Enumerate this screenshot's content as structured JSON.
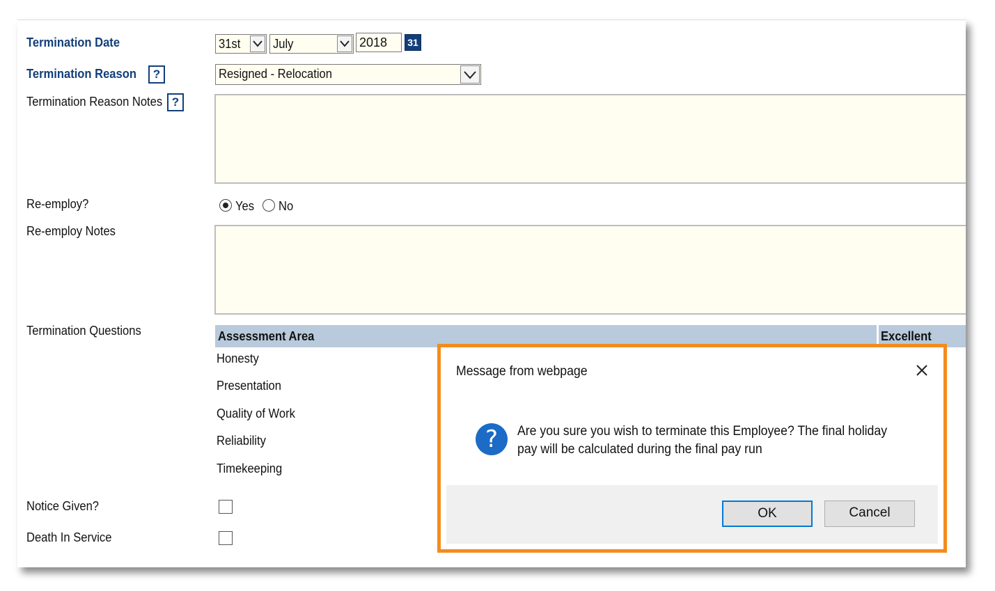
{
  "form": {
    "termination_date_label": "Termination Date",
    "date_day": "31st",
    "date_month": "July",
    "date_year": "2018",
    "calendar_label": "31",
    "termination_reason_label": "Termination Reason",
    "termination_reason_value": "Resigned - Relocation",
    "termination_reason_notes_label": "Termination Reason Notes",
    "help_symbol": "?",
    "reemploy_label": "Re-employ?",
    "reemploy_yes": "Yes",
    "reemploy_no": "No",
    "reemploy_selected": "Yes",
    "reemploy_notes_label": "Re-employ Notes",
    "termination_questions_label": "Termination Questions",
    "table_headers": [
      "Assessment Area",
      "Excellent"
    ],
    "assessment_rows": [
      "Honesty",
      "Presentation",
      "Quality of Work",
      "Reliability",
      "Timekeeping"
    ],
    "notice_given_label": "Notice Given?",
    "death_in_service_label": "Death In Service"
  },
  "dialog": {
    "title": "Message from webpage",
    "message": "Are you sure you wish to terminate this Employee? The final holiday pay will be calculated during the final pay run",
    "ok_label": "OK",
    "cancel_label": "Cancel",
    "icon": "question-icon",
    "highlight_color": "#f28c1e"
  },
  "colors": {
    "label_blue": "#123f7a",
    "field_background": "#fffef0",
    "table_header": "#b8cadb"
  }
}
